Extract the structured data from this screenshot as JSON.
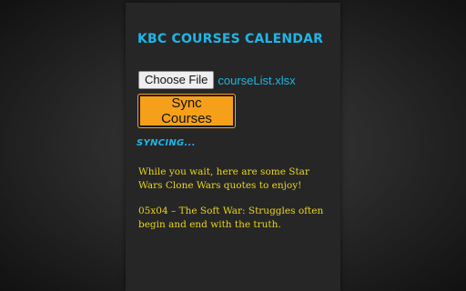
{
  "header": {
    "title": "KBC COURSES CALENDAR"
  },
  "file_picker": {
    "button_label": "Choose File",
    "file_name": "courseList.xlsx"
  },
  "actions": {
    "sync_label": "Sync Courses"
  },
  "status": {
    "text": "SYNCING..."
  },
  "quotes": {
    "intro": "While you wait, here are some Star Wars Clone Wars quotes to enjoy!",
    "current": "05x04 – The Soft War: Struggles often begin and end with the truth."
  },
  "colors": {
    "accent_blue": "#1fb5e6",
    "button_orange": "#f6a01a",
    "quote_yellow": "#e9d51c",
    "panel_bg": "#262626"
  }
}
